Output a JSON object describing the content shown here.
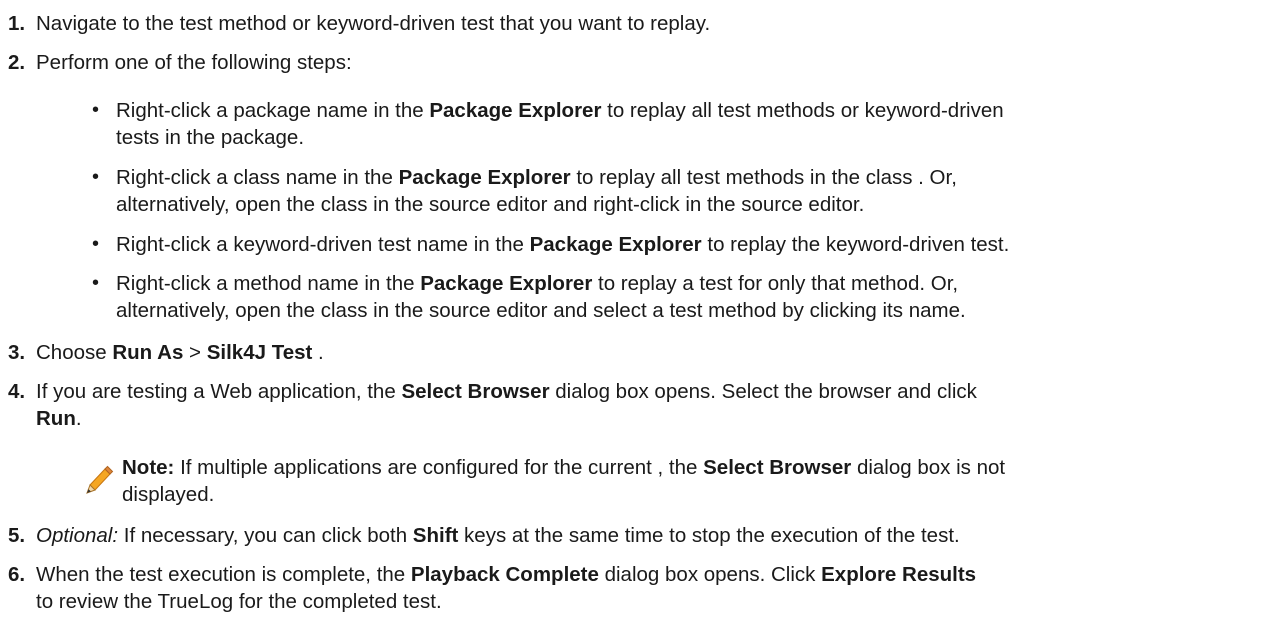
{
  "steps": [
    {
      "number": "1.",
      "text": "Navigate to the test method or keyword-driven test that you want to replay."
    },
    {
      "number": "2.",
      "text": "Perform one of the following steps:",
      "bullets": [
        {
          "pre": "Right-click a package name in the ",
          "bold": "Package Explorer",
          "post": " to replay all test methods or keyword-driven",
          "cont": "tests in the package."
        },
        {
          "pre": "Right-click a class name in the ",
          "bold": "Package Explorer",
          "post": " to replay all test methods in the class . Or,",
          "cont": "alternatively, open the class in the source editor and right-click in the source editor."
        },
        {
          "pre": "Right-click a keyword-driven test name in the ",
          "bold": "Package Explorer",
          "post": " to replay the keyword-driven test."
        },
        {
          "pre": "Right-click a method name in the ",
          "bold": "Package Explorer",
          "post": " to replay a test for only that method. Or,",
          "cont": "alternatively, open the class in the source editor and select a test method by clicking its name."
        }
      ]
    },
    {
      "number": "3.",
      "pre": "Choose ",
      "bold1": "Run As",
      "mid": " > ",
      "bold2": "Silk4J Test",
      "post": " ."
    },
    {
      "number": "4.",
      "pre": "If you are testing a Web application, the ",
      "bold1": "Select Browser",
      "mid": " dialog box opens. Select the browser and click",
      "bold2": "Run",
      "post": ".",
      "note": {
        "label": "Note:",
        "pre": " If multiple applications are configured for the current , the ",
        "bold": "Select Browser",
        "post": " dialog box is not",
        "cont": "displayed.",
        "icon": "pencil-icon"
      }
    },
    {
      "number": "5.",
      "italic": "Optional:",
      "pre": " If necessary, you can click both ",
      "bold": "Shift",
      "post": " keys at the same time to stop the execution of the test."
    },
    {
      "number": "6.",
      "pre": "When the test execution is complete, the ",
      "bold1": "Playback Complete",
      "mid": " dialog box opens. Click ",
      "bold2": "Explore Results",
      "cont": "to review the TrueLog for the completed test."
    }
  ]
}
